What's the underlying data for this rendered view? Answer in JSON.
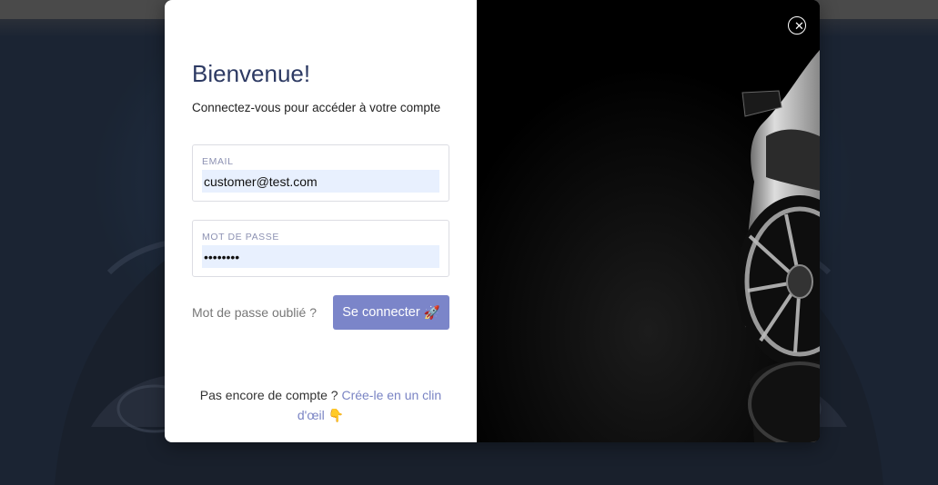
{
  "modal": {
    "title": "Bienvenue!",
    "subtitle": "Connectez-vous pour accéder à votre compte",
    "email": {
      "label": "EMAIL",
      "value": "customer@test.com"
    },
    "password": {
      "label": "MOT DE PASSE",
      "value": "password"
    },
    "forgot_label": "Mot de passe oublié ?",
    "login_label": "Se connecter",
    "login_emoji": "🚀",
    "signup_prefix": "Pas encore de compte ?",
    "signup_link": "Crée-le en un clin d'œil",
    "signup_emoji": "👇",
    "close_icon": "close-icon"
  },
  "colors": {
    "title": "#2d3a63",
    "button": "#7b85c9",
    "link": "#7a84c4",
    "input_bg": "#e8f0fe"
  }
}
